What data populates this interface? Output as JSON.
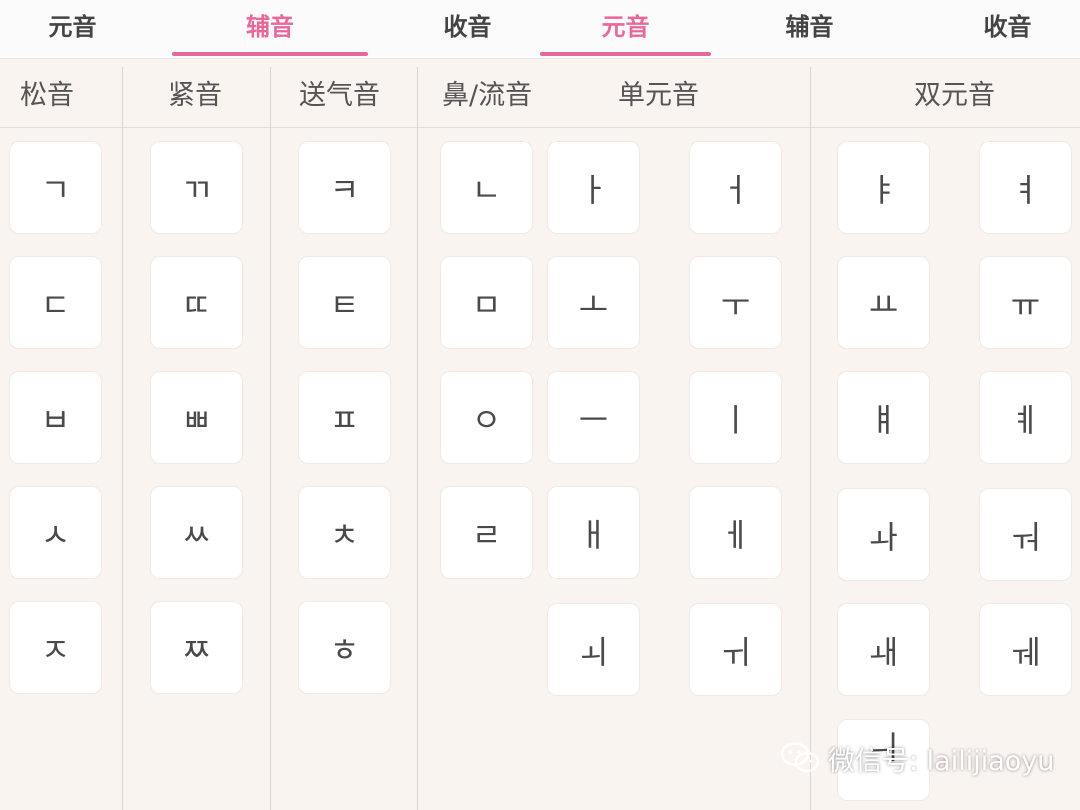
{
  "tabs": [
    {
      "label": "元音",
      "active": false
    },
    {
      "label": "辅音",
      "active": true
    },
    {
      "label": "收音",
      "active": false
    },
    {
      "label": "元音",
      "active": true
    },
    {
      "label": "辅音",
      "active": false
    },
    {
      "label": "收音",
      "active": false
    }
  ],
  "headers": {
    "lax": "松音",
    "tense": "紧音",
    "aspirated": "送气音",
    "nasal_liquid": "鼻/流音",
    "monophthong": "单元音",
    "diphthong": "双元音"
  },
  "consonants": {
    "lax": [
      "ㄱ",
      "ㄷ",
      "ㅂ",
      "ㅅ",
      "ㅈ"
    ],
    "tense": [
      "ㄲ",
      "ㄸ",
      "ㅃ",
      "ㅆ",
      "ㅉ"
    ],
    "aspirated": [
      "ㅋ",
      "ㅌ",
      "ㅍ",
      "ㅊ",
      "ㅎ"
    ],
    "nasal_liquid": [
      "ㄴ",
      "ㅁ",
      "ㅇ",
      "ㄹ"
    ]
  },
  "vowels": {
    "monophthong_a": [
      "ㅏ",
      "ㅗ",
      "ㅡ",
      "ㅐ",
      "ㅚ"
    ],
    "monophthong_b": [
      "ㅓ",
      "ㅜ",
      "ㅣ",
      "ㅔ",
      "ㅟ"
    ],
    "diphthong_a": [
      "ㅑ",
      "ㅛ",
      "ㅒ",
      "ㅘ",
      "ㅙ",
      "ㅢ"
    ],
    "diphthong_b": [
      "ㅕ",
      "ㅠ",
      "ㅖ",
      "ㅝ",
      "ㅞ"
    ]
  },
  "watermark": {
    "text": "微信号: lailijiaoyu",
    "icon": "wechat-icon"
  },
  "colors": {
    "accent": "#e8689b",
    "background": "#faf4f1",
    "key": "#ffffff"
  }
}
